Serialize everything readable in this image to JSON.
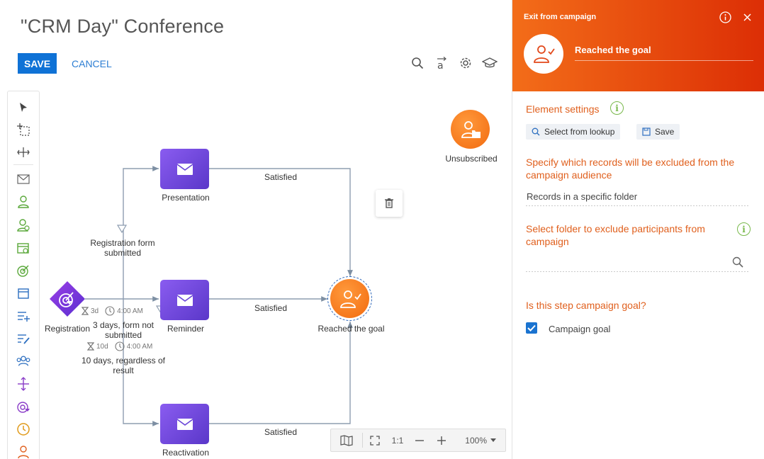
{
  "header": {
    "title": "\"CRM Day\" Conference",
    "save_label": "SAVE",
    "cancel_label": "CANCEL"
  },
  "toolbar_icons": [
    "pointer-icon",
    "marquee-select-icon",
    "fit-icon",
    "email-icon",
    "audience-icon",
    "add-audience-icon",
    "event-icon",
    "goal-icon",
    "calendar-icon",
    "add-records-icon",
    "modify-records-icon",
    "group-icon",
    "split-icon",
    "target-filter-icon",
    "timer-icon",
    "exit-icon"
  ],
  "canvas": {
    "nodes": {
      "presentation": "Presentation",
      "reminder": "Reminder",
      "reactivation": "Reactivation",
      "registration": "Registration",
      "reached_goal": "Reached the goal",
      "unsubscribed": "Unsubscribed"
    },
    "flows": {
      "satisfied_top": "Satisfied",
      "satisfied_mid": "Satisfied",
      "satisfied_bottom": "Satisfied",
      "registration_form": "Registration form submitted",
      "three_days": "3 days, form not submitted",
      "ten_days": "10 days, regardless of result"
    },
    "timers": {
      "t1_days": "3d",
      "t1_time": "4:00 AM",
      "t2_days": "10d",
      "t2_time": "4:00 AM"
    },
    "zoom": {
      "ratio": "1:1",
      "level": "100%"
    }
  },
  "panel": {
    "header_title": "Exit from campaign",
    "element_name": "Reached the goal",
    "element_settings": "Element settings",
    "select_lookup": "Select from lookup",
    "save": "Save",
    "specify_title": "Specify which records will be excluded from the campaign audience",
    "records_value": "Records in a specific folder",
    "folder_title": "Select folder to exclude participants from campaign",
    "folder_value": "",
    "goal_question": "Is this step campaign goal?",
    "goal_checkbox_label": "Campaign goal",
    "goal_checked": true
  },
  "colors": {
    "primary_blue": "#0f72d6",
    "accent_orange": "#e0601e",
    "node_purple": "#6a45d8",
    "green_icon": "#5aa83a"
  }
}
